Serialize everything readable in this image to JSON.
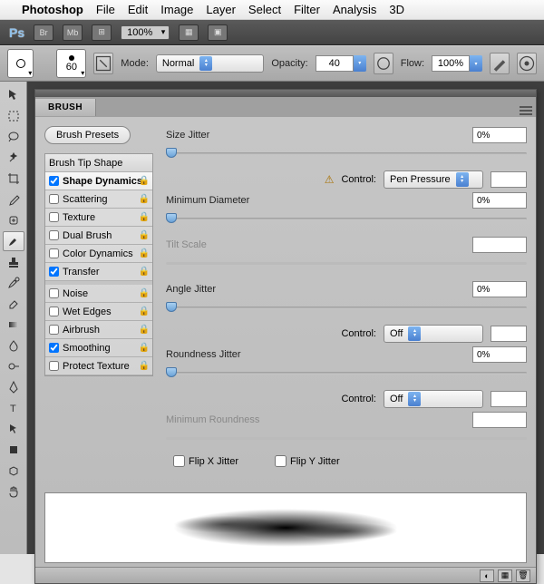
{
  "menubar": {
    "app": "Photoshop",
    "items": [
      "File",
      "Edit",
      "Image",
      "Layer",
      "Select",
      "Filter",
      "Analysis",
      "3D"
    ]
  },
  "toolbar": {
    "zoom": "100%"
  },
  "optbar": {
    "brush_size": "60",
    "mode_label": "Mode:",
    "mode_value": "Normal",
    "opacity_label": "Opacity:",
    "opacity_value": "40",
    "flow_label": "Flow:",
    "flow_value": "100%"
  },
  "panel": {
    "tab": "BRUSH",
    "presets_btn": "Brush Presets",
    "list": {
      "header": "Brush Tip Shape",
      "items": [
        {
          "label": "Shape Dynamics",
          "checked": true,
          "active": true
        },
        {
          "label": "Scattering",
          "checked": false
        },
        {
          "label": "Texture",
          "checked": false
        },
        {
          "label": "Dual Brush",
          "checked": false
        },
        {
          "label": "Color Dynamics",
          "checked": false
        },
        {
          "label": "Transfer",
          "checked": true
        }
      ],
      "items2": [
        {
          "label": "Noise",
          "checked": false
        },
        {
          "label": "Wet Edges",
          "checked": false
        },
        {
          "label": "Airbrush",
          "checked": false
        },
        {
          "label": "Smoothing",
          "checked": true
        },
        {
          "label": "Protect Texture",
          "checked": false
        }
      ]
    },
    "controls": {
      "size_jitter": {
        "label": "Size Jitter",
        "value": "0%"
      },
      "size_control": {
        "label": "Control:",
        "value": "Pen Pressure",
        "num": ""
      },
      "min_diameter": {
        "label": "Minimum Diameter",
        "value": "0%"
      },
      "tilt_scale": {
        "label": "Tilt Scale",
        "value": ""
      },
      "angle_jitter": {
        "label": "Angle Jitter",
        "value": "0%"
      },
      "angle_control": {
        "label": "Control:",
        "value": "Off",
        "num": ""
      },
      "round_jitter": {
        "label": "Roundness Jitter",
        "value": "0%"
      },
      "round_control": {
        "label": "Control:",
        "value": "Off",
        "num": ""
      },
      "min_round": {
        "label": "Minimum Roundness",
        "value": ""
      },
      "flip_x": "Flip X Jitter",
      "flip_y": "Flip Y Jitter"
    }
  }
}
